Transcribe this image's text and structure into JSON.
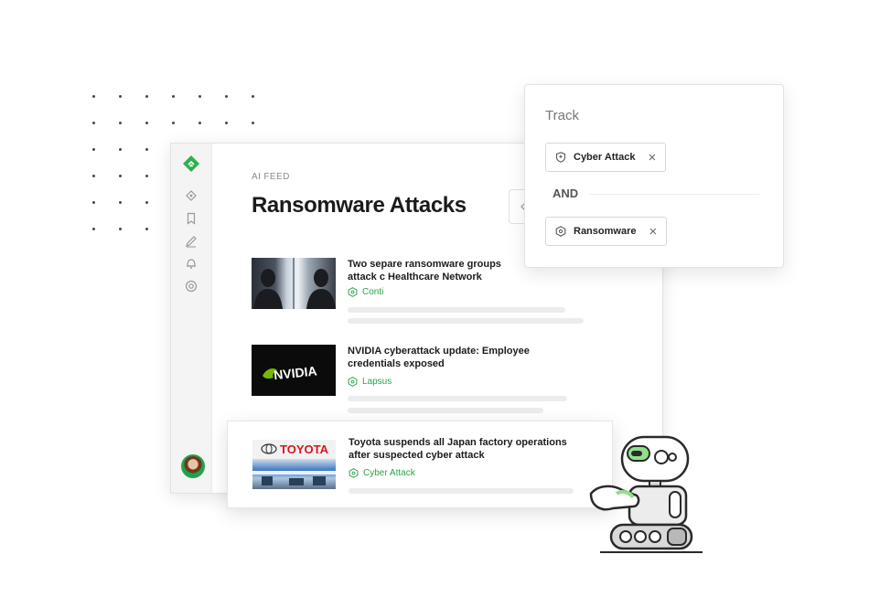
{
  "feed": {
    "label": "AI FEED",
    "title": "Ransomware Attacks"
  },
  "sidebar": {
    "icons": [
      "feedly-logo-icon",
      "tag-icon",
      "bookmark-icon",
      "pencil-icon",
      "bell-icon",
      "support-icon"
    ],
    "avatar": "user-avatar"
  },
  "articles": [
    {
      "title": "Two separe ransomware groups attack c Healthcare Network",
      "tag": "Conti"
    },
    {
      "title": "NVIDIA cyberattack update: Employee credentials exposed",
      "tag": "Lapsus",
      "thumb_text": "NVIDIA"
    },
    {
      "title": "Toyota suspends all Japan factory operations after suspected cyber attack",
      "tag": "Cyber Attack",
      "thumb_text": "TOYOTA"
    }
  ],
  "track": {
    "title": "Track",
    "operator": "AND",
    "chips": [
      {
        "label": "Cyber Attack",
        "icon": "shield-icon"
      },
      {
        "label": "Ransomware",
        "icon": "hexagon-icon"
      }
    ],
    "remove_label": "×"
  },
  "colors": {
    "accent": "#2bb24c",
    "tag_text": "#2aa34a"
  }
}
